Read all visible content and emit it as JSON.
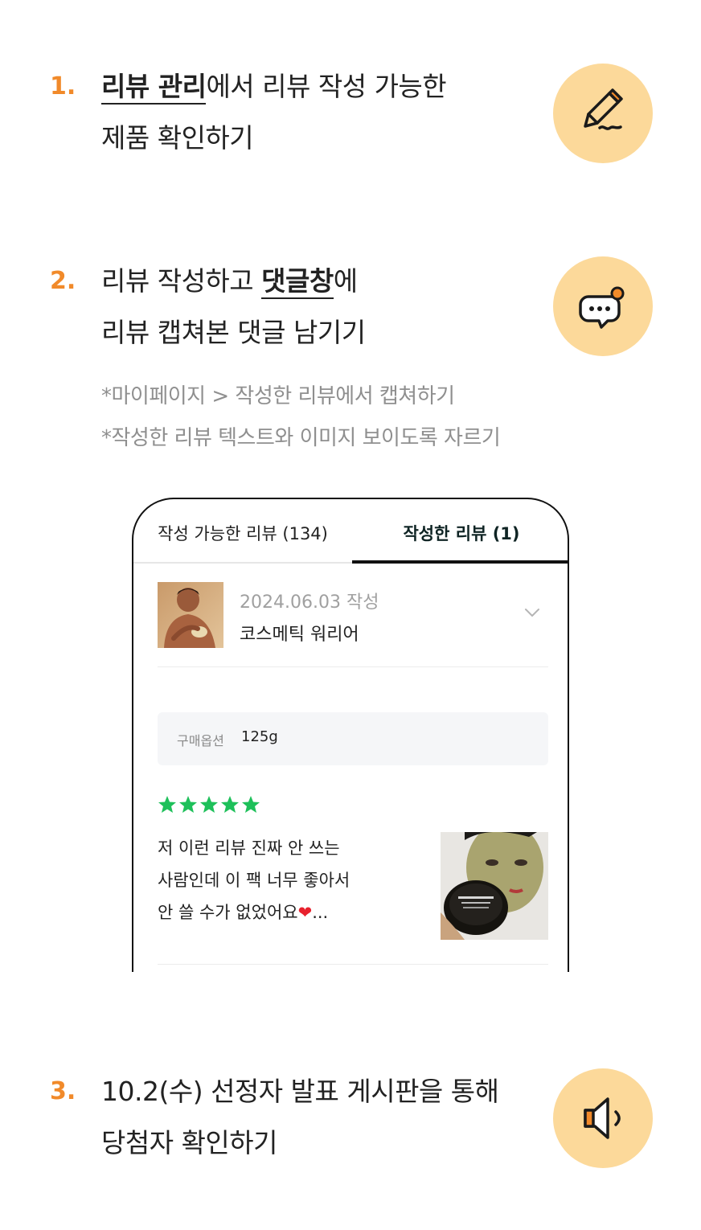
{
  "steps": [
    {
      "num": "1.",
      "line1_bold": "리뷰 관리",
      "line1_rest": "에서 리뷰 작성 가능한",
      "line2": "제품 확인하기",
      "icon": "pencil-icon"
    },
    {
      "num": "2.",
      "line1_pre": "리뷰 작성하고 ",
      "line1_bold": "댓글창",
      "line1_post": "에",
      "line2": "리뷰 캡쳐본 댓글 남기기",
      "icon": "chat-bubble-icon",
      "notes": [
        "*마이페이지 > 작성한 리뷰에서 캡쳐하기",
        "*작성한 리뷰 텍스트와 이미지 보이도록 자르기"
      ]
    },
    {
      "num": "3.",
      "line1": "10.2(수) 선정자 발표 게시판을 통해",
      "line2": "당첨자 확인하기",
      "icon": "megaphone-icon"
    }
  ],
  "phone": {
    "tabs": [
      {
        "label": "작성 가능한 리뷰 (134)",
        "active": false
      },
      {
        "label": "작성한 리뷰 (1)",
        "active": true
      }
    ],
    "review_item": {
      "date": "2024.06.03 작성",
      "product_name": "코스메틱 워리어",
      "option_label": "구매옵션",
      "option_value": "125g",
      "rating": 5,
      "text_lines": [
        "저 이런 리뷰 진짜 안 쓰는",
        "사람인데 이 팩 너무 좋아서",
        "안 쓸 수가 없었어요"
      ],
      "text_tail": "...",
      "heart": "❤"
    }
  },
  "colors": {
    "accent_orange": "#f18a2a",
    "icon_circle": "#fcd99a",
    "star_green": "#1ec05a",
    "heart_red": "#e8212d"
  }
}
